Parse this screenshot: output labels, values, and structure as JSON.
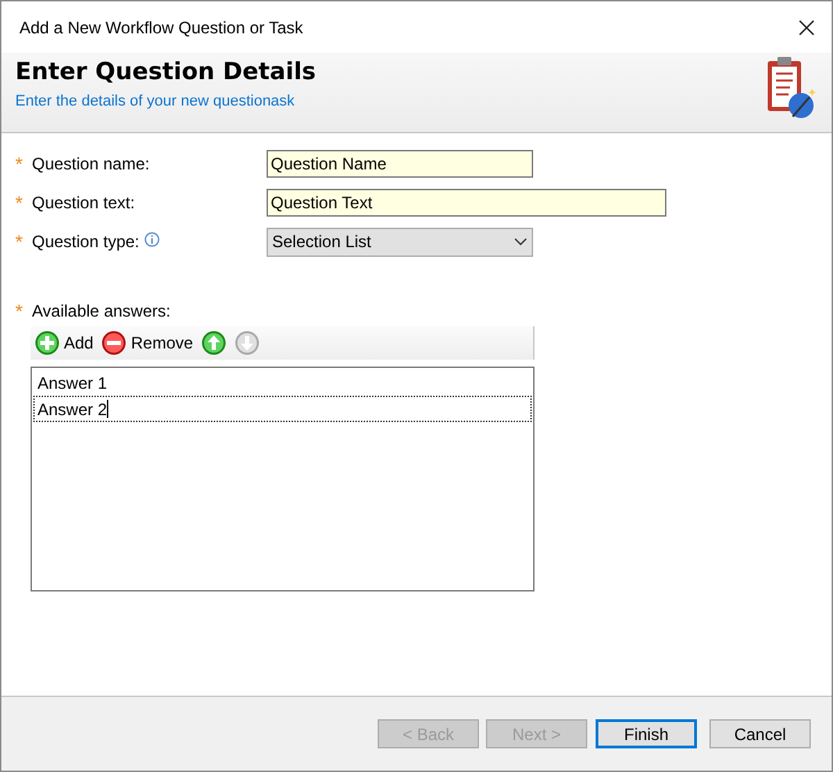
{
  "window": {
    "title": "Add a New Workflow Question or Task"
  },
  "header": {
    "title": "Enter Question Details",
    "subtitle": "Enter the details of your new questionask"
  },
  "fields": [
    {
      "kind": "text",
      "marker": "*",
      "label": "Question name:",
      "value": "Question Name"
    },
    {
      "kind": "wide_text",
      "marker": "*",
      "label": "Question text:",
      "value": "Question Text"
    },
    {
      "kind": "select",
      "marker": "*",
      "label": "Question type:",
      "info": true,
      "value": "Selection List"
    }
  ],
  "answers": {
    "marker": "*",
    "label": "Available answers:",
    "toolbar": [
      {
        "kind": "add",
        "label": "Add",
        "disabled": false
      },
      {
        "kind": "remove",
        "label": "Remove",
        "disabled": false
      },
      {
        "kind": "up",
        "disabled": false
      },
      {
        "kind": "down",
        "disabled": true
      }
    ],
    "items": [
      {
        "text": "Answer 1",
        "selected": false
      },
      {
        "text": "Answer 2",
        "selected": true
      }
    ]
  },
  "buttons": [
    {
      "label": "< Back",
      "disabled": true,
      "default": false
    },
    {
      "label": "Next >",
      "disabled": true,
      "default": false
    },
    {
      "label": "Finish",
      "disabled": false,
      "default": true
    },
    {
      "label": "Cancel",
      "disabled": false,
      "default": false
    }
  ]
}
